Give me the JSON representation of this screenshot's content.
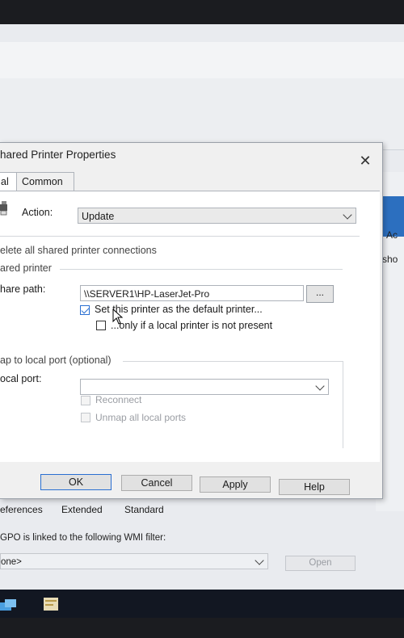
{
  "dialog": {
    "title": "hared Printer Properties",
    "close": "✕",
    "tabs": [
      {
        "label": "al"
      },
      {
        "label": "Common"
      }
    ],
    "action_label": "Action:",
    "action_value": "Update",
    "delete_all": "elete all shared printer connections",
    "shared_printer_group": "ared printer",
    "share_path_label": "hare path:",
    "share_path_value": "\\\\SERVER1\\HP-LaserJet-Pro",
    "browse_label": "...",
    "set_default_label": "Set this printer as the default printer...",
    "set_default_checked": true,
    "only_local_label": "...only if a local printer is not present",
    "only_local_checked": false,
    "map_local_group": "ap to local port (optional)",
    "local_port_label": "ocal port:",
    "local_port_value": "",
    "reconnect_label": "Reconnect",
    "unmap_label": "Unmap all local ports",
    "buttons": {
      "ok": "OK",
      "cancel": "Cancel",
      "apply": "Apply",
      "help": "Help"
    }
  },
  "background": {
    "right_text_1": "Ac",
    "right_text_2": "o sho"
  },
  "gpo": {
    "tabs": [
      {
        "label": "eferences"
      },
      {
        "label": "Extended"
      },
      {
        "label": "Standard"
      }
    ],
    "wmi_text": "GPO is linked to the following WMI filter:",
    "wmi_value": "one>",
    "open_label": "Open"
  },
  "colors": {
    "accent": "#2a6fd1",
    "selection_blue": "#2c6fbf"
  }
}
